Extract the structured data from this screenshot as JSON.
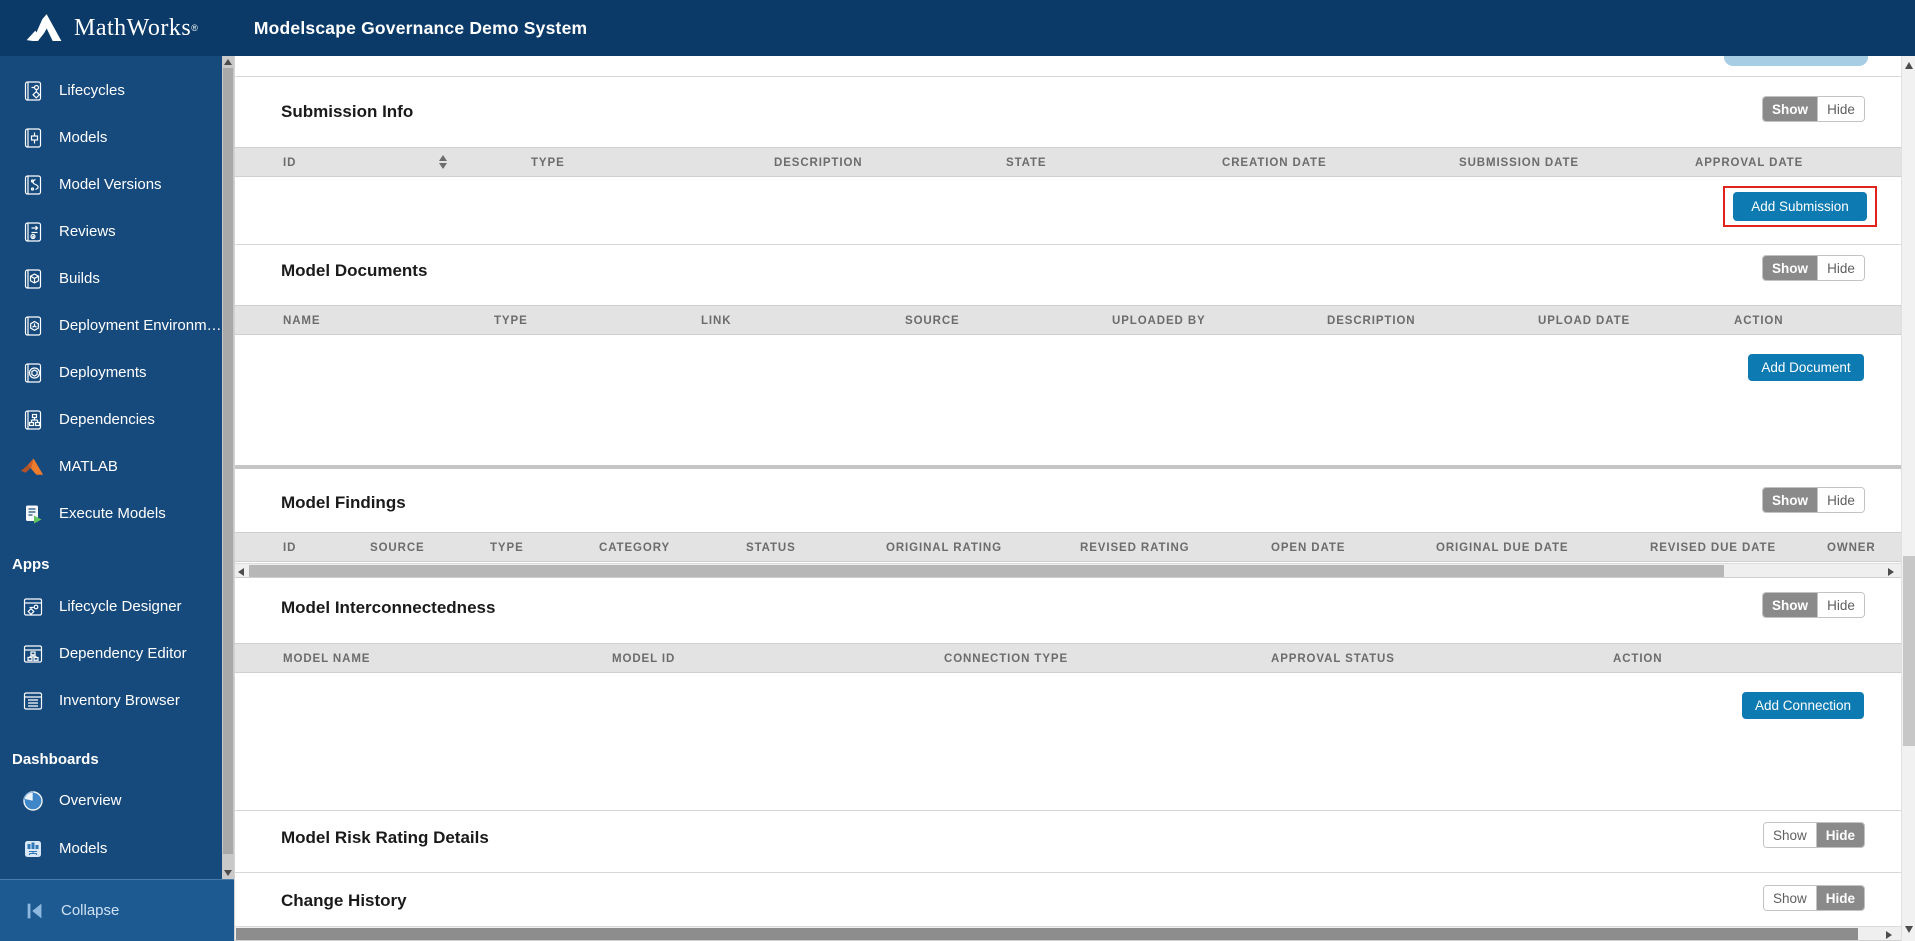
{
  "header": {
    "brand": "MathWorks",
    "registered": "®",
    "title": "Modelscape Governance Demo System"
  },
  "sidebar": {
    "nav_items": [
      {
        "label": "Lifecycles",
        "icon": "lifecycles-icon"
      },
      {
        "label": "Models",
        "icon": "models-icon"
      },
      {
        "label": "Model Versions",
        "icon": "model-versions-icon"
      },
      {
        "label": "Reviews",
        "icon": "reviews-icon"
      },
      {
        "label": "Builds",
        "icon": "builds-icon"
      },
      {
        "label": "Deployment Environm…",
        "icon": "deployment-environments-icon"
      },
      {
        "label": "Deployments",
        "icon": "deployments-icon"
      },
      {
        "label": "Dependencies",
        "icon": "dependencies-icon"
      },
      {
        "label": "MATLAB",
        "icon": "matlab-icon"
      },
      {
        "label": "Execute Models",
        "icon": "execute-models-icon"
      }
    ],
    "apps_header": "Apps",
    "apps_items": [
      {
        "label": "Lifecycle Designer",
        "icon": "lifecycle-designer-icon"
      },
      {
        "label": "Dependency Editor",
        "icon": "dependency-editor-icon"
      },
      {
        "label": "Inventory Browser",
        "icon": "inventory-browser-icon"
      }
    ],
    "dashboards_header": "Dashboards",
    "dashboard_items": [
      {
        "label": "Overview",
        "icon": "pie-chart-icon"
      },
      {
        "label": "Models",
        "icon": "bar-chart-icon"
      }
    ],
    "collapse_label": "Collapse"
  },
  "toggle": {
    "show": "Show",
    "hide": "Hide"
  },
  "sections": {
    "submission_info": {
      "title": "Submission Info",
      "columns": [
        "ID",
        "TYPE",
        "DESCRIPTION",
        "STATE",
        "CREATION DATE",
        "SUBMISSION DATE",
        "APPROVAL DATE"
      ],
      "add_button": "Add Submission",
      "toggle_state": "show"
    },
    "model_documents": {
      "title": "Model Documents",
      "columns": [
        "NAME",
        "TYPE",
        "LINK",
        "SOURCE",
        "UPLOADED BY",
        "DESCRIPTION",
        "UPLOAD DATE",
        "ACTION"
      ],
      "add_button": "Add Document",
      "toggle_state": "show"
    },
    "model_findings": {
      "title": "Model Findings",
      "columns": [
        "ID",
        "SOURCE",
        "TYPE",
        "CATEGORY",
        "STATUS",
        "ORIGINAL RATING",
        "REVISED RATING",
        "OPEN DATE",
        "ORIGINAL DUE DATE",
        "REVISED DUE DATE",
        "OWNER"
      ],
      "toggle_state": "show"
    },
    "model_interconnectedness": {
      "title": "Model Interconnectedness",
      "columns": [
        "MODEL NAME",
        "MODEL ID",
        "CONNECTION TYPE",
        "APPROVAL STATUS",
        "ACTION"
      ],
      "add_button": "Add Connection",
      "toggle_state": "show"
    },
    "model_risk_rating": {
      "title": "Model Risk Rating Details",
      "toggle_state": "hide"
    },
    "change_history": {
      "title": "Change History",
      "toggle_state": "hide"
    }
  },
  "colors": {
    "header_navy": "#0b3a69",
    "sidebar_navy": "#16497c",
    "accent_blue": "#0d7ab2",
    "highlight_red": "#e0241b",
    "table_header_bg": "#e3e3e3"
  }
}
